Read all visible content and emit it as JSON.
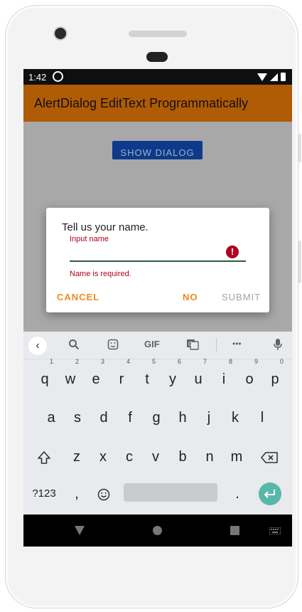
{
  "status_bar": {
    "time": "1:42"
  },
  "app_bar": {
    "title": "AlertDialog EditText Programmatically"
  },
  "main": {
    "show_dialog_label": "SHOW DIALOG"
  },
  "dialog": {
    "title": "Tell us your name.",
    "field_label": "Input name",
    "input_value": "",
    "error_icon": "!",
    "error_text": "Name is required.",
    "cancel_label": "CANCEL",
    "no_label": "NO",
    "submit_label": "SUBMIT"
  },
  "keyboard": {
    "toolbar": {
      "back": "‹",
      "gif": "GIF",
      "more": "•••"
    },
    "row1": [
      "q",
      "w",
      "e",
      "r",
      "t",
      "y",
      "u",
      "i",
      "o",
      "p"
    ],
    "row1_numbers": [
      "1",
      "2",
      "3",
      "4",
      "5",
      "6",
      "7",
      "8",
      "9",
      "0"
    ],
    "row2": [
      "a",
      "s",
      "d",
      "f",
      "g",
      "h",
      "j",
      "k",
      "l"
    ],
    "row3": [
      "z",
      "x",
      "c",
      "v",
      "b",
      "n",
      "m"
    ],
    "symbols_label": "?123",
    "comma": ",",
    "period": "."
  },
  "colors": {
    "app_bar": "#b05b05",
    "accent": "#f08a1e",
    "error": "#b00020",
    "primary_button": "#0d3a8a",
    "enter_key": "#57b8a9"
  },
  "icons": {
    "status": [
      "sync-icon",
      "wifi-icon",
      "signal-icon",
      "battery-icon"
    ],
    "keyboard_toolbar": [
      "search-icon",
      "sticker-icon",
      "gif-icon",
      "translate-icon",
      "more-icon",
      "microphone-icon"
    ],
    "nav": [
      "back-icon",
      "home-icon",
      "recents-icon",
      "keyboard-switch-icon"
    ]
  }
}
